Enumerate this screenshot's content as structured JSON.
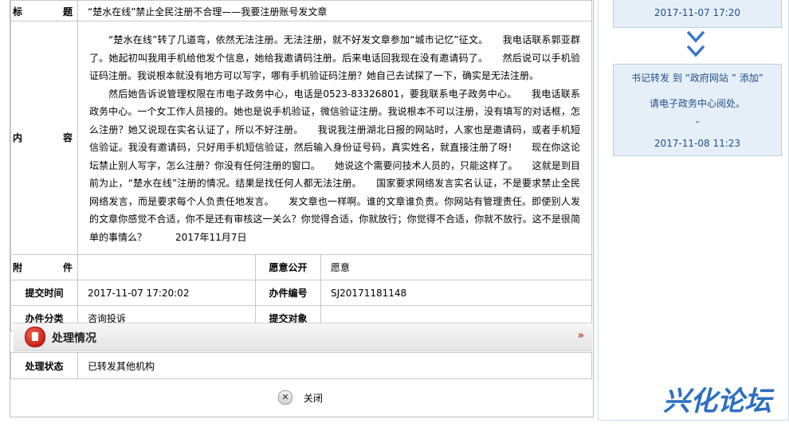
{
  "form": {
    "title_label": "标 题",
    "title_value": "“楚水在线”禁止全民注册不合理——我要注册账号发文章",
    "content_label": "内 容",
    "content_paragraphs": [
      "“楚水在线”转了几道弯，依然无法注册。无法注册，就不好发文章参加“城市记忆”征文。　　我电话联系郭亚群了。她起初叫我用手机给他发个信息，她给我邀请码注册。后来电话回我现在没有邀请码了。　　然后说可以手机验证码注册。我说根本就没有地方可以写字，哪有手机验证码注册？她自己去试探了一下，确实是无法注册。",
      "然后她告诉说管理权限在市电子政务中心，电话是0523-83326801，要我联系电子政务中心。　　我电话联系政务中心。一个女工作人员接的。她也是说手机验证，微信验证注册。我说根本不可以注册，没有填写的对话框，怎么注册？她又说现在实名认证了，所以不好注册。　　我说我注册湖北日报的网站时，人家也是邀请码，或者手机短信验证。我没有邀请码，只好用手机短信验证，然后输入身份证号码，真实姓名，就直接注册了呀!　　现在你这论坛禁止别人写字，怎么注册？你没有任何注册的窗口。　　她说这个需要问技术人员的，只能这样了。　　这就是到目前为止，“楚水在线”注册的情况。结果是找任何人都无法注册。　　国家要求网络发言实名认证，不是要求禁止全民网络发言，而是要求每个人负责任地发言。　　发文章也一样啊。谁的文章谁负责。你网站有管理责任。即使别人发的文章你感觉不合适，你不是还有审核这一关么？你觉得合适，你就放行；你觉得不合适，你就不放行。这不是很简单的事情么？　　　2017年11月7日"
    ],
    "attachment_label": "附 件",
    "attachment_value": "",
    "public_label": "愿意公开",
    "public_value": "愿意",
    "submit_time_label": "提交时间",
    "submit_time_value": "2017-11-07 17:20:02",
    "case_no_label": "办件编号",
    "case_no_value": "SJ20171181148",
    "category_label": "办件分类",
    "category_value": "咨询投诉",
    "target_label": "提交对象",
    "target_value": ""
  },
  "processing": {
    "header": "处理情况",
    "arrow": "»",
    "status_label": "处理状态",
    "status_value": "已转发其他机构"
  },
  "close_label": "关闭",
  "flow": {
    "box1_time": "2017-11-07 17:20",
    "box2_line1": "书记转发 到 “政府网站 ” 添加”",
    "box2_line2": "请电子政务中心阅处。",
    "box2_line3": "”",
    "box2_time": "2017-11-08 11:23"
  },
  "logo_text": "兴化论坛",
  "colors": {
    "flow_text": "#1e4f8a",
    "flow_bg": "#e6eff8",
    "accent_red": "#c9201a",
    "logo_blue": "#2d6fc1"
  }
}
